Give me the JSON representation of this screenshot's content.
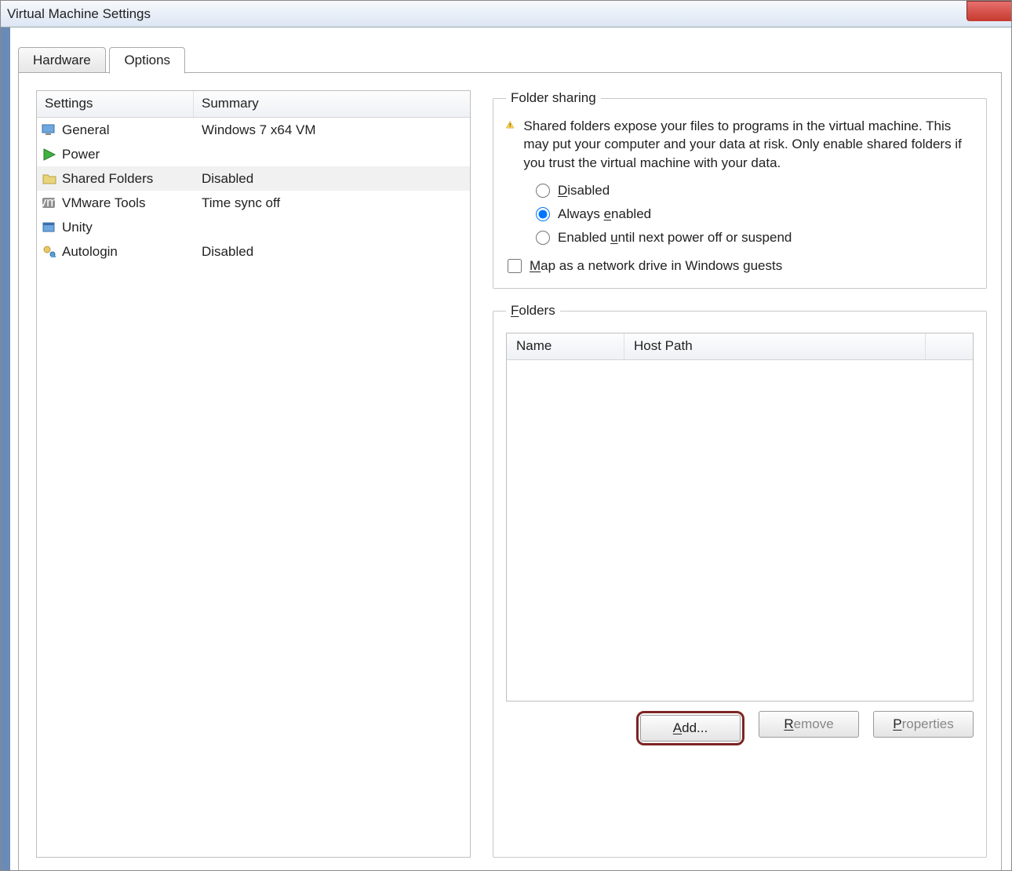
{
  "window": {
    "title": "Virtual Machine Settings"
  },
  "tabs": {
    "hardware": "Hardware",
    "options": "Options",
    "active": "Options"
  },
  "list": {
    "head_settings": "Settings",
    "head_summary": "Summary",
    "rows": [
      {
        "name": "General",
        "summary": "Windows 7 x64 VM"
      },
      {
        "name": "Power",
        "summary": ""
      },
      {
        "name": "Shared Folders",
        "summary": "Disabled"
      },
      {
        "name": "VMware Tools",
        "summary": "Time sync off"
      },
      {
        "name": "Unity",
        "summary": ""
      },
      {
        "name": "Autologin",
        "summary": "Disabled"
      }
    ]
  },
  "sharing": {
    "legend": "Folder sharing",
    "warning": "Shared folders expose your files to programs in the virtual machine. This may put your computer and your data at risk. Only enable shared folders if you trust the virtual machine with your data.",
    "opt_disabled": "Disabled",
    "opt_always": "Always enabled",
    "opt_until": "Enabled until next power off or suspend",
    "selected": "always",
    "map_label": "Map as a network drive in Windows guests",
    "map_checked": false
  },
  "folders": {
    "legend": "Folders",
    "col_name": "Name",
    "col_path": "Host Path",
    "rows": []
  },
  "buttons": {
    "add": "Add...",
    "remove": "Remove",
    "properties": "Properties"
  }
}
